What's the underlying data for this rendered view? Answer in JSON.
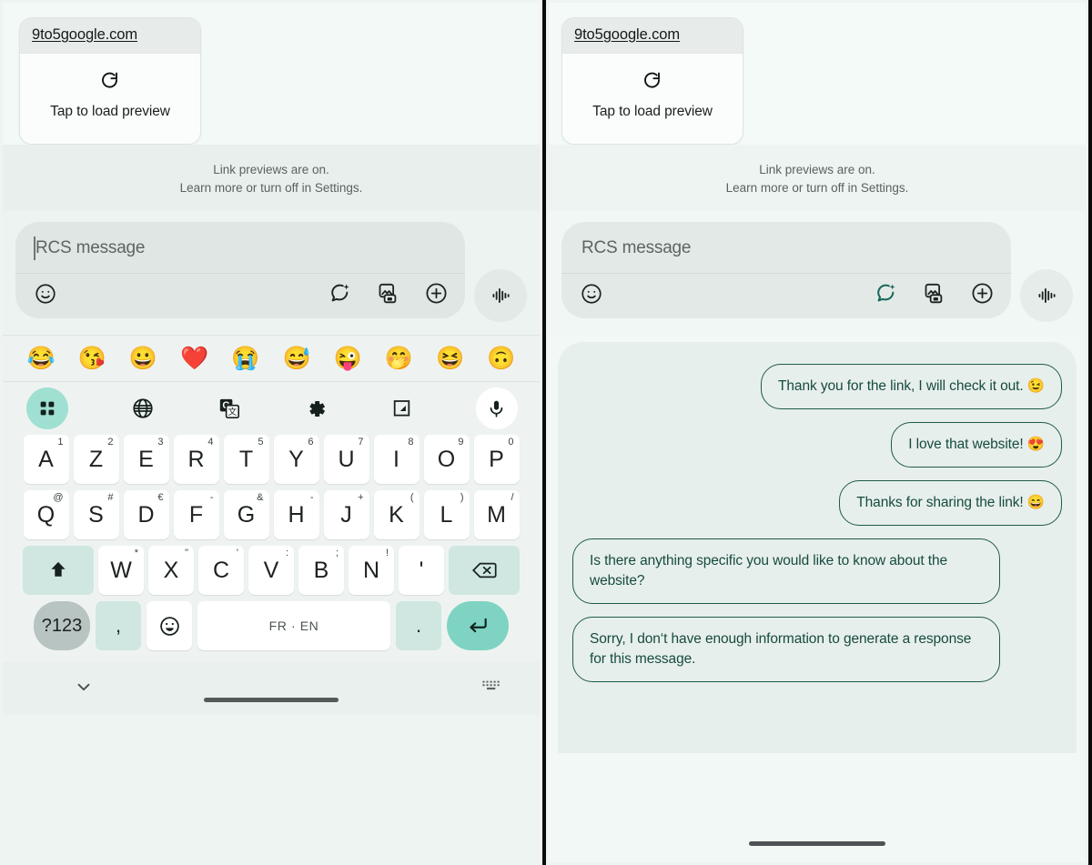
{
  "app": {
    "name": "Google Messages RCS composer",
    "accent_teal": "#7ed3c2",
    "accent_mint": "#9fe0d2",
    "bubble_outline": "#1f5a4c",
    "background": "#eef3f1",
    "keyboard_key": "#ffffff"
  },
  "link_preview": {
    "url": "9to5google.com",
    "reload_icon": "refresh-icon",
    "cta_label": "Tap to load preview"
  },
  "notice": {
    "line1": "Link previews are on.",
    "line2": "Learn more or turn off in Settings."
  },
  "composer": {
    "placeholder": "RCS message",
    "value": "",
    "actions": [
      {
        "name": "emoji-icon",
        "label": "Emoji"
      },
      {
        "name": "magic-reply-icon",
        "label": "Smart reply"
      },
      {
        "name": "gallery-icon",
        "label": "Gallery"
      },
      {
        "name": "plus-icon",
        "label": "More"
      }
    ],
    "voice_button": {
      "name": "voice-waveform-icon",
      "label": "Voice message"
    }
  },
  "emoji_suggestions": [
    "😂",
    "😘",
    "😀",
    "❤️",
    "😭",
    "😅",
    "😜",
    "🤭",
    "😆",
    "🙃"
  ],
  "keyboard_toolbar": [
    {
      "name": "apps-grid-icon",
      "label": "Toolbar",
      "active": true
    },
    {
      "name": "globe-icon",
      "label": "Language"
    },
    {
      "name": "translate-icon",
      "label": "Translate"
    },
    {
      "name": "gear-icon",
      "label": "Settings"
    },
    {
      "name": "handwriting-icon",
      "label": "Handwriting"
    },
    {
      "name": "microphone-icon",
      "label": "Voice typing",
      "active": true
    }
  ],
  "keyboard": {
    "layout_name": "AZERTY",
    "row1": [
      {
        "key": "A",
        "sup": "1"
      },
      {
        "key": "Z",
        "sup": "2"
      },
      {
        "key": "E",
        "sup": "3"
      },
      {
        "key": "R",
        "sup": "4"
      },
      {
        "key": "T",
        "sup": "5"
      },
      {
        "key": "Y",
        "sup": "6"
      },
      {
        "key": "U",
        "sup": "7"
      },
      {
        "key": "I",
        "sup": "8"
      },
      {
        "key": "O",
        "sup": "9"
      },
      {
        "key": "P",
        "sup": "0"
      }
    ],
    "row2": [
      {
        "key": "Q",
        "sup": "@"
      },
      {
        "key": "S",
        "sup": "#"
      },
      {
        "key": "D",
        "sup": "€"
      },
      {
        "key": "F",
        "sup": "-"
      },
      {
        "key": "G",
        "sup": "&"
      },
      {
        "key": "H",
        "sup": "-"
      },
      {
        "key": "J",
        "sup": "+"
      },
      {
        "key": "K",
        "sup": "("
      },
      {
        "key": "L",
        "sup": ")"
      },
      {
        "key": "M",
        "sup": "/"
      }
    ],
    "row3_shift": "shift-icon",
    "row3": [
      {
        "key": "W",
        "sup": "*"
      },
      {
        "key": "X",
        "sup": "\""
      },
      {
        "key": "C",
        "sup": "'"
      },
      {
        "key": "V",
        "sup": ":"
      },
      {
        "key": "B",
        "sup": ";"
      },
      {
        "key": "N",
        "sup": "!"
      },
      {
        "key": "'",
        "sup": ""
      }
    ],
    "row3_backspace": "backspace-icon",
    "bottom": {
      "symbols_label": "?123",
      "comma_label": ",",
      "emoji_label": "☺",
      "space_label": "FR · EN",
      "period_label": ".",
      "enter_label": "enter-icon"
    }
  },
  "keyboard_navbar": {
    "collapse_icon": "chevron-down-icon",
    "keyboard_switch_icon": "keyboard-icon"
  },
  "conversation": {
    "messages": [
      {
        "align": "right",
        "text": "Thank you for the link, I will check it out. 😉",
        "lines": 1
      },
      {
        "align": "right",
        "text": "I love that website! 😍",
        "lines": 1
      },
      {
        "align": "right",
        "text": "Thanks for sharing the link! 😄",
        "lines": 1
      },
      {
        "align": "left",
        "text": "Is there anything specific you would like to know about the website?",
        "lines": 2
      },
      {
        "align": "left",
        "text": "Sorry, I don‘t have enough information to generate a response for this message.",
        "lines": 2
      }
    ]
  }
}
